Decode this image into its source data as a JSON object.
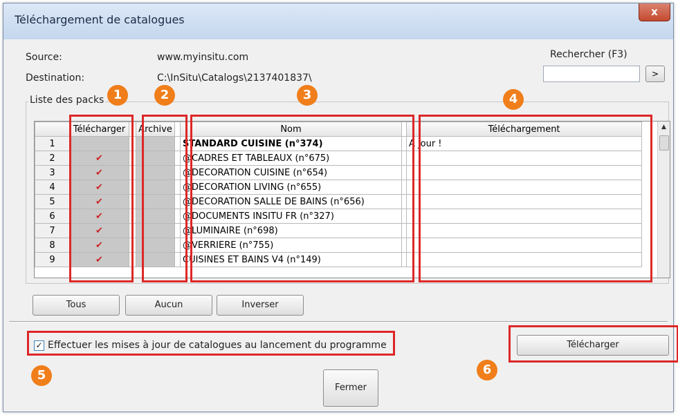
{
  "window": {
    "title": "Téléchargement de catalogues",
    "close_label": "x"
  },
  "source": {
    "label": "Source:",
    "value": "www.myinsitu.com"
  },
  "destination": {
    "label": "Destination:",
    "value": "C:\\InSitu\\Catalogs\\2137401837\\"
  },
  "search": {
    "label": "Rechercher (F3)",
    "value": "",
    "button_label": ">"
  },
  "packs": {
    "group_label": "Liste des packs",
    "columns": {
      "download": "Télécharger",
      "archive": "Archive",
      "name": "Nom",
      "progress": "Téléchargement"
    },
    "rows": [
      {
        "num": "1",
        "checked": false,
        "name": "STANDARD CUISINE (n°374)",
        "status": "A jour !"
      },
      {
        "num": "2",
        "checked": true,
        "name": "@CADRES ET TABLEAUX (n°675)",
        "status": ""
      },
      {
        "num": "3",
        "checked": true,
        "name": "@DECORATION CUISINE (n°654)",
        "status": ""
      },
      {
        "num": "4",
        "checked": true,
        "name": "@DECORATION LIVING (n°655)",
        "status": ""
      },
      {
        "num": "5",
        "checked": true,
        "name": "@DECORATION SALLE DE BAINS (n°656)",
        "status": ""
      },
      {
        "num": "6",
        "checked": true,
        "name": "@DOCUMENTS INSITU FR (n°327)",
        "status": ""
      },
      {
        "num": "7",
        "checked": true,
        "name": "@LUMINAIRE (n°698)",
        "status": ""
      },
      {
        "num": "8",
        "checked": true,
        "name": "@VERRIERE (n°755)",
        "status": ""
      },
      {
        "num": "9",
        "checked": true,
        "name": "CUISINES ET BAINS V4 (n°149)",
        "status": ""
      }
    ]
  },
  "buttons": {
    "all": "Tous",
    "none": "Aucun",
    "invert": "Inverser",
    "download": "Télécharger",
    "close": "Fermer"
  },
  "auto_update": {
    "checked": true,
    "label": "Effectuer les mises à jour de catalogues au lancement du programme"
  },
  "callouts": [
    "1",
    "2",
    "3",
    "4",
    "5",
    "6"
  ],
  "colors": {
    "highlight": "#dd2727",
    "badge": "#f07e1a",
    "check": "#cc2222"
  }
}
